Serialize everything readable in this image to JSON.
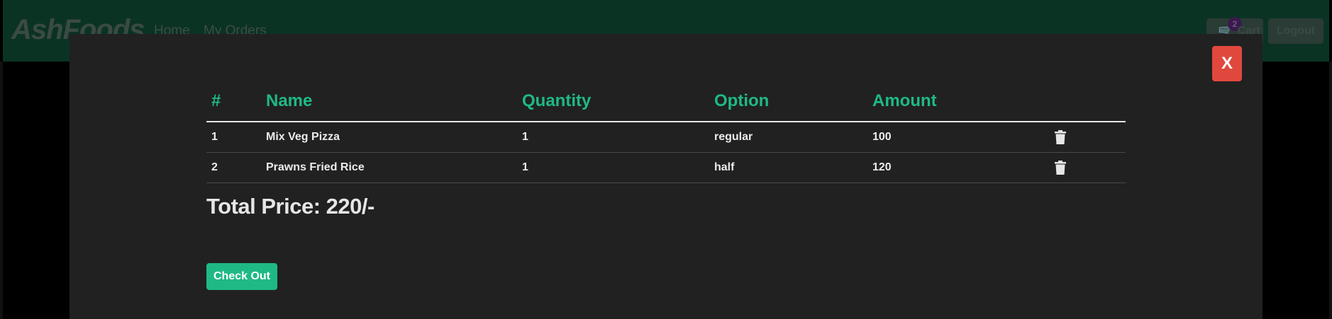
{
  "navbar": {
    "brand": "AshFoods",
    "links": [
      "Home",
      "My Orders"
    ],
    "cart_label": "Cart",
    "cart_count": "2",
    "logout_label": "Logout"
  },
  "modal": {
    "close_label": "X",
    "table": {
      "headers": [
        "#",
        "Name",
        "Quantity",
        "Option",
        "Amount"
      ],
      "rows": [
        {
          "index": "1",
          "name": "Mix Veg Pizza",
          "quantity": "1",
          "option": "regular",
          "amount": "100"
        },
        {
          "index": "2",
          "name": "Prawns Fried Rice",
          "quantity": "1",
          "option": "half",
          "amount": "120"
        }
      ]
    },
    "total_price": "Total Price: 220/-",
    "checkout_label": "Check Out"
  },
  "colors": {
    "accent": "#1fb985",
    "close": "#e0483e",
    "navbar": "#0b3324",
    "modal_bg": "#212121"
  },
  "icons": {
    "delete": "trash-icon",
    "cart": "cart-icon"
  }
}
